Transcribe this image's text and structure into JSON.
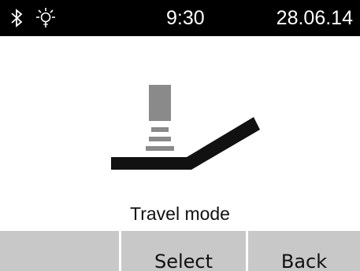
{
  "status_bar": {
    "bluetooth_icon": "bluetooth-icon",
    "light_icon": "light-bulb-icon",
    "time": "9:30",
    "date": "28.06.14"
  },
  "main": {
    "illustration_icon": "travel-mode-icon",
    "mode_label": "Travel mode"
  },
  "softkeys": {
    "left_label": "",
    "middle_label": "Select",
    "right_label": "Back"
  },
  "colors": {
    "status_bar_bg": "#000000",
    "softkey_bg": "#c8c8c8",
    "illustration_gray": "#8a8a8a",
    "illustration_dark": "#111111"
  }
}
